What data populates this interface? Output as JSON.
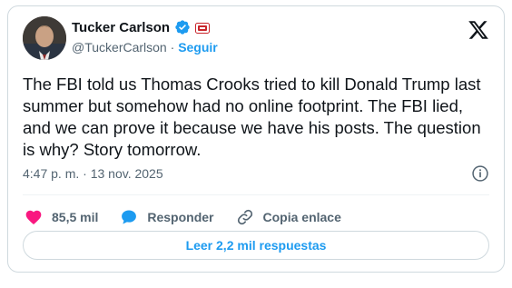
{
  "author": {
    "name": "Tucker Carlson",
    "handle": "@TuckerCarlson",
    "separator": "·",
    "follow_label": "Seguir"
  },
  "tweet": {
    "text": "The FBI told us Thomas Crooks tried to kill Donald Trump last summer but somehow had no online footprint. The FBI lied, and we can prove it because we have his posts. The question is why? Story tomorrow.",
    "timestamp": "4:47 p. m. · 13 nov. 2025"
  },
  "actions": {
    "likes": "85,5 mil",
    "reply_label": "Responder",
    "copy_label": "Copia enlace"
  },
  "replies_button_label": "Leer 2,2 mil respuestas",
  "colors": {
    "accent": "#1d9bf0",
    "like": "#f91880",
    "text": "#0f1419",
    "muted": "#536471",
    "border": "#cfd9de"
  },
  "icons": [
    "verified-badge-icon",
    "tv-badge-icon",
    "x-logo-icon",
    "info-icon",
    "heart-icon",
    "reply-bubble-icon",
    "link-icon"
  ]
}
